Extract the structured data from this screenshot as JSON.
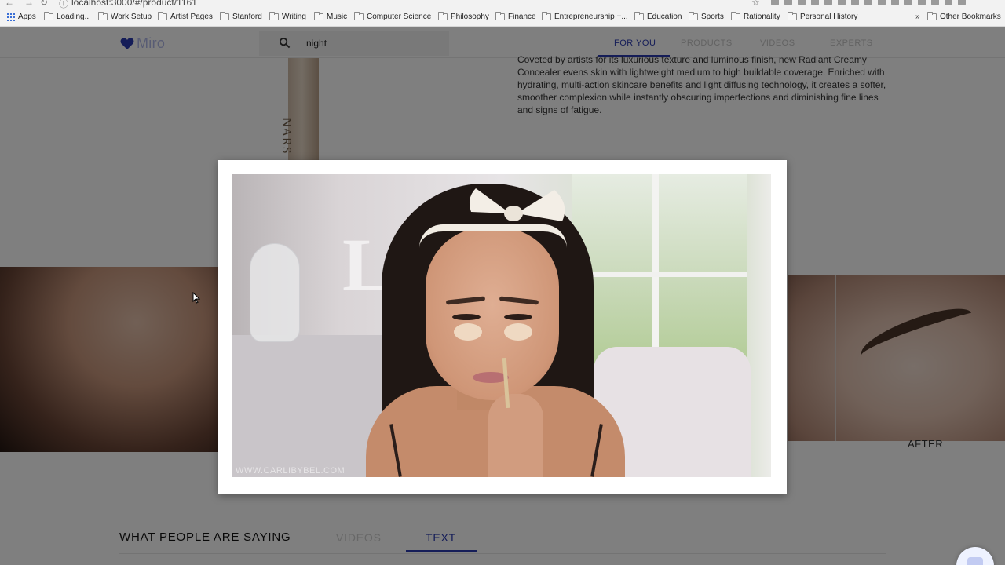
{
  "browser": {
    "url": "localhost:3000/#/product/1161",
    "bookmarks": [
      {
        "label": "Apps",
        "type": "apps"
      },
      {
        "label": "Loading...",
        "type": "folder"
      },
      {
        "label": "Work Setup",
        "type": "folder"
      },
      {
        "label": "Artist Pages",
        "type": "folder"
      },
      {
        "label": "Stanford",
        "type": "folder"
      },
      {
        "label": "Writing",
        "type": "folder"
      },
      {
        "label": "Music",
        "type": "folder"
      },
      {
        "label": "Computer Science",
        "type": "folder"
      },
      {
        "label": "Philosophy",
        "type": "folder"
      },
      {
        "label": "Finance",
        "type": "folder"
      },
      {
        "label": "Entrepreneurship +...",
        "type": "folder"
      },
      {
        "label": "Education",
        "type": "folder"
      },
      {
        "label": "Sports",
        "type": "folder"
      },
      {
        "label": "Rationality",
        "type": "folder"
      },
      {
        "label": "Personal History",
        "type": "folder"
      }
    ],
    "overflow_label": "»",
    "other_bookmarks": "Other Bookmarks"
  },
  "header": {
    "logo_text": "Miro",
    "search_value": "night",
    "tabs": [
      {
        "label": "FOR YOU",
        "active": true
      },
      {
        "label": "PRODUCTS",
        "active": false
      },
      {
        "label": "VIDEOS",
        "active": false
      },
      {
        "label": "EXPERTS",
        "active": false
      }
    ]
  },
  "product": {
    "brand": "NARS",
    "description": "Coveted by artists for its luxurious texture and luminous finish, new Radiant Creamy Concealer evens skin with lightweight medium to high buildable coverage. Enriched with hydrating, multi-action skincare benefits and light diffusing technology, it creates a softer, smoother complexion while instantly obscuring imperfections and diminishing fine lines and signs of fatigue."
  },
  "gallery": {
    "after_label": "AFTER"
  },
  "reviews": {
    "title": "WHAT PEOPLE ARE SAYING",
    "tabs": [
      {
        "label": "VIDEOS",
        "active": false
      },
      {
        "label": "TEXT",
        "active": true
      }
    ]
  },
  "modal": {
    "video_watermark": "WWW.CARLIBYBEL.COM"
  },
  "colors": {
    "accent": "#2a3bb0",
    "logo_heart": "#2a3bb0",
    "overlay": "rgba(0,0,0,0.5)"
  }
}
